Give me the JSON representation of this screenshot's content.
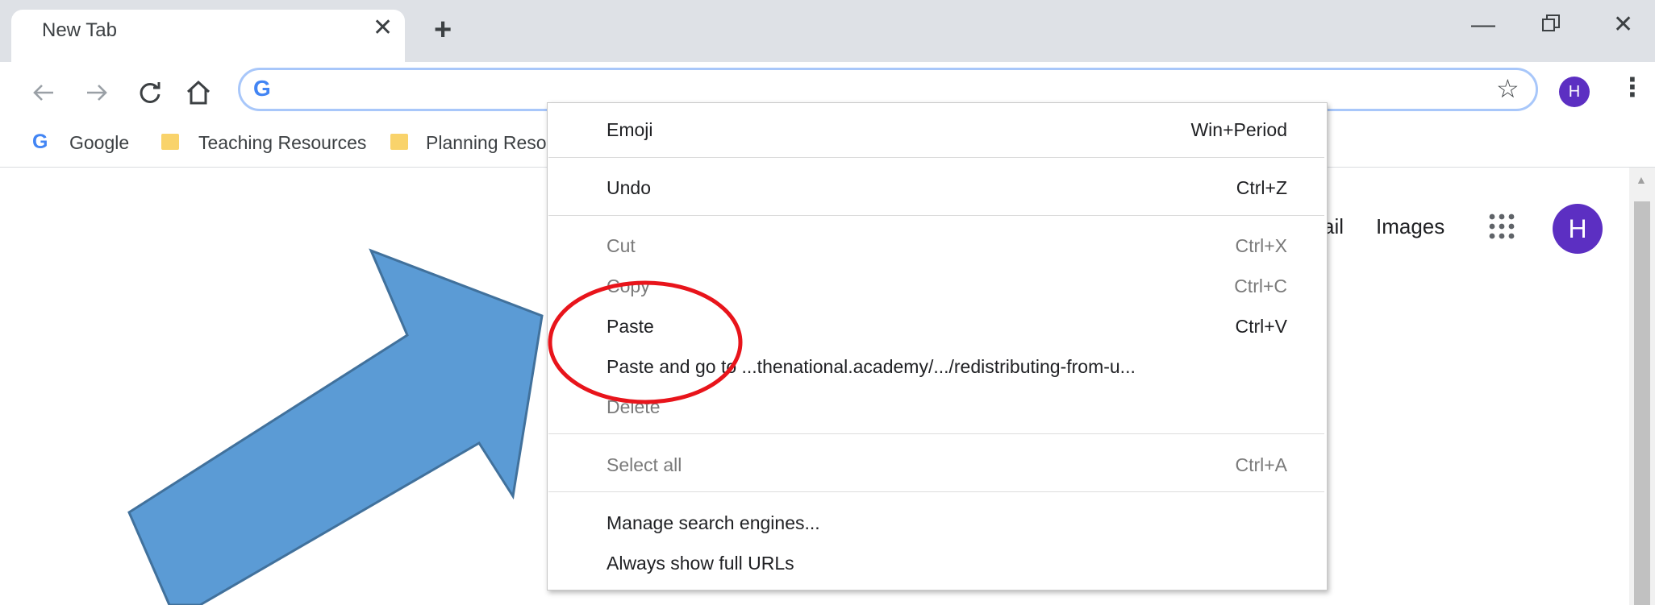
{
  "tab": {
    "title": "New Tab"
  },
  "bookmarks": [
    {
      "label": "Google"
    },
    {
      "label": "Teaching Resources"
    },
    {
      "label": "Planning Reso"
    }
  ],
  "page": {
    "links": [
      "ail",
      "Images"
    ],
    "avatar_letter": "H"
  },
  "toolbar": {
    "avatar_letter": "H"
  },
  "context_menu": {
    "items": [
      {
        "label": "Emoji",
        "shortcut": "Win+Period",
        "enabled": true
      },
      {
        "label": "Undo",
        "shortcut": "Ctrl+Z",
        "enabled": true
      },
      {
        "label": "Cut",
        "shortcut": "Ctrl+X",
        "enabled": false
      },
      {
        "label": "Copy",
        "shortcut": "Ctrl+C",
        "enabled": false
      },
      {
        "label": "Paste",
        "shortcut": "Ctrl+V",
        "enabled": true
      },
      {
        "label": "Paste and go to ...thenational.academy/.../redistributing-from-u...",
        "shortcut": "",
        "enabled": true
      },
      {
        "label": "Delete",
        "shortcut": "",
        "enabled": false
      },
      {
        "label": "Select all",
        "shortcut": "Ctrl+A",
        "enabled": false
      },
      {
        "label": "Manage search engines...",
        "shortcut": "",
        "enabled": true
      },
      {
        "label": "Always show full URLs",
        "shortcut": "",
        "enabled": true
      }
    ]
  },
  "annotations": {
    "arrow_color": "#5b9bd5",
    "highlight_color": "#e8141b",
    "highlighted_item": "Paste"
  },
  "icons": [
    "back-icon",
    "forward-icon",
    "reload-icon",
    "home-icon",
    "google-g-icon",
    "star-icon",
    "kebab-menu-icon",
    "apps-grid-icon",
    "folder-icon",
    "close-icon",
    "plus-icon"
  ]
}
